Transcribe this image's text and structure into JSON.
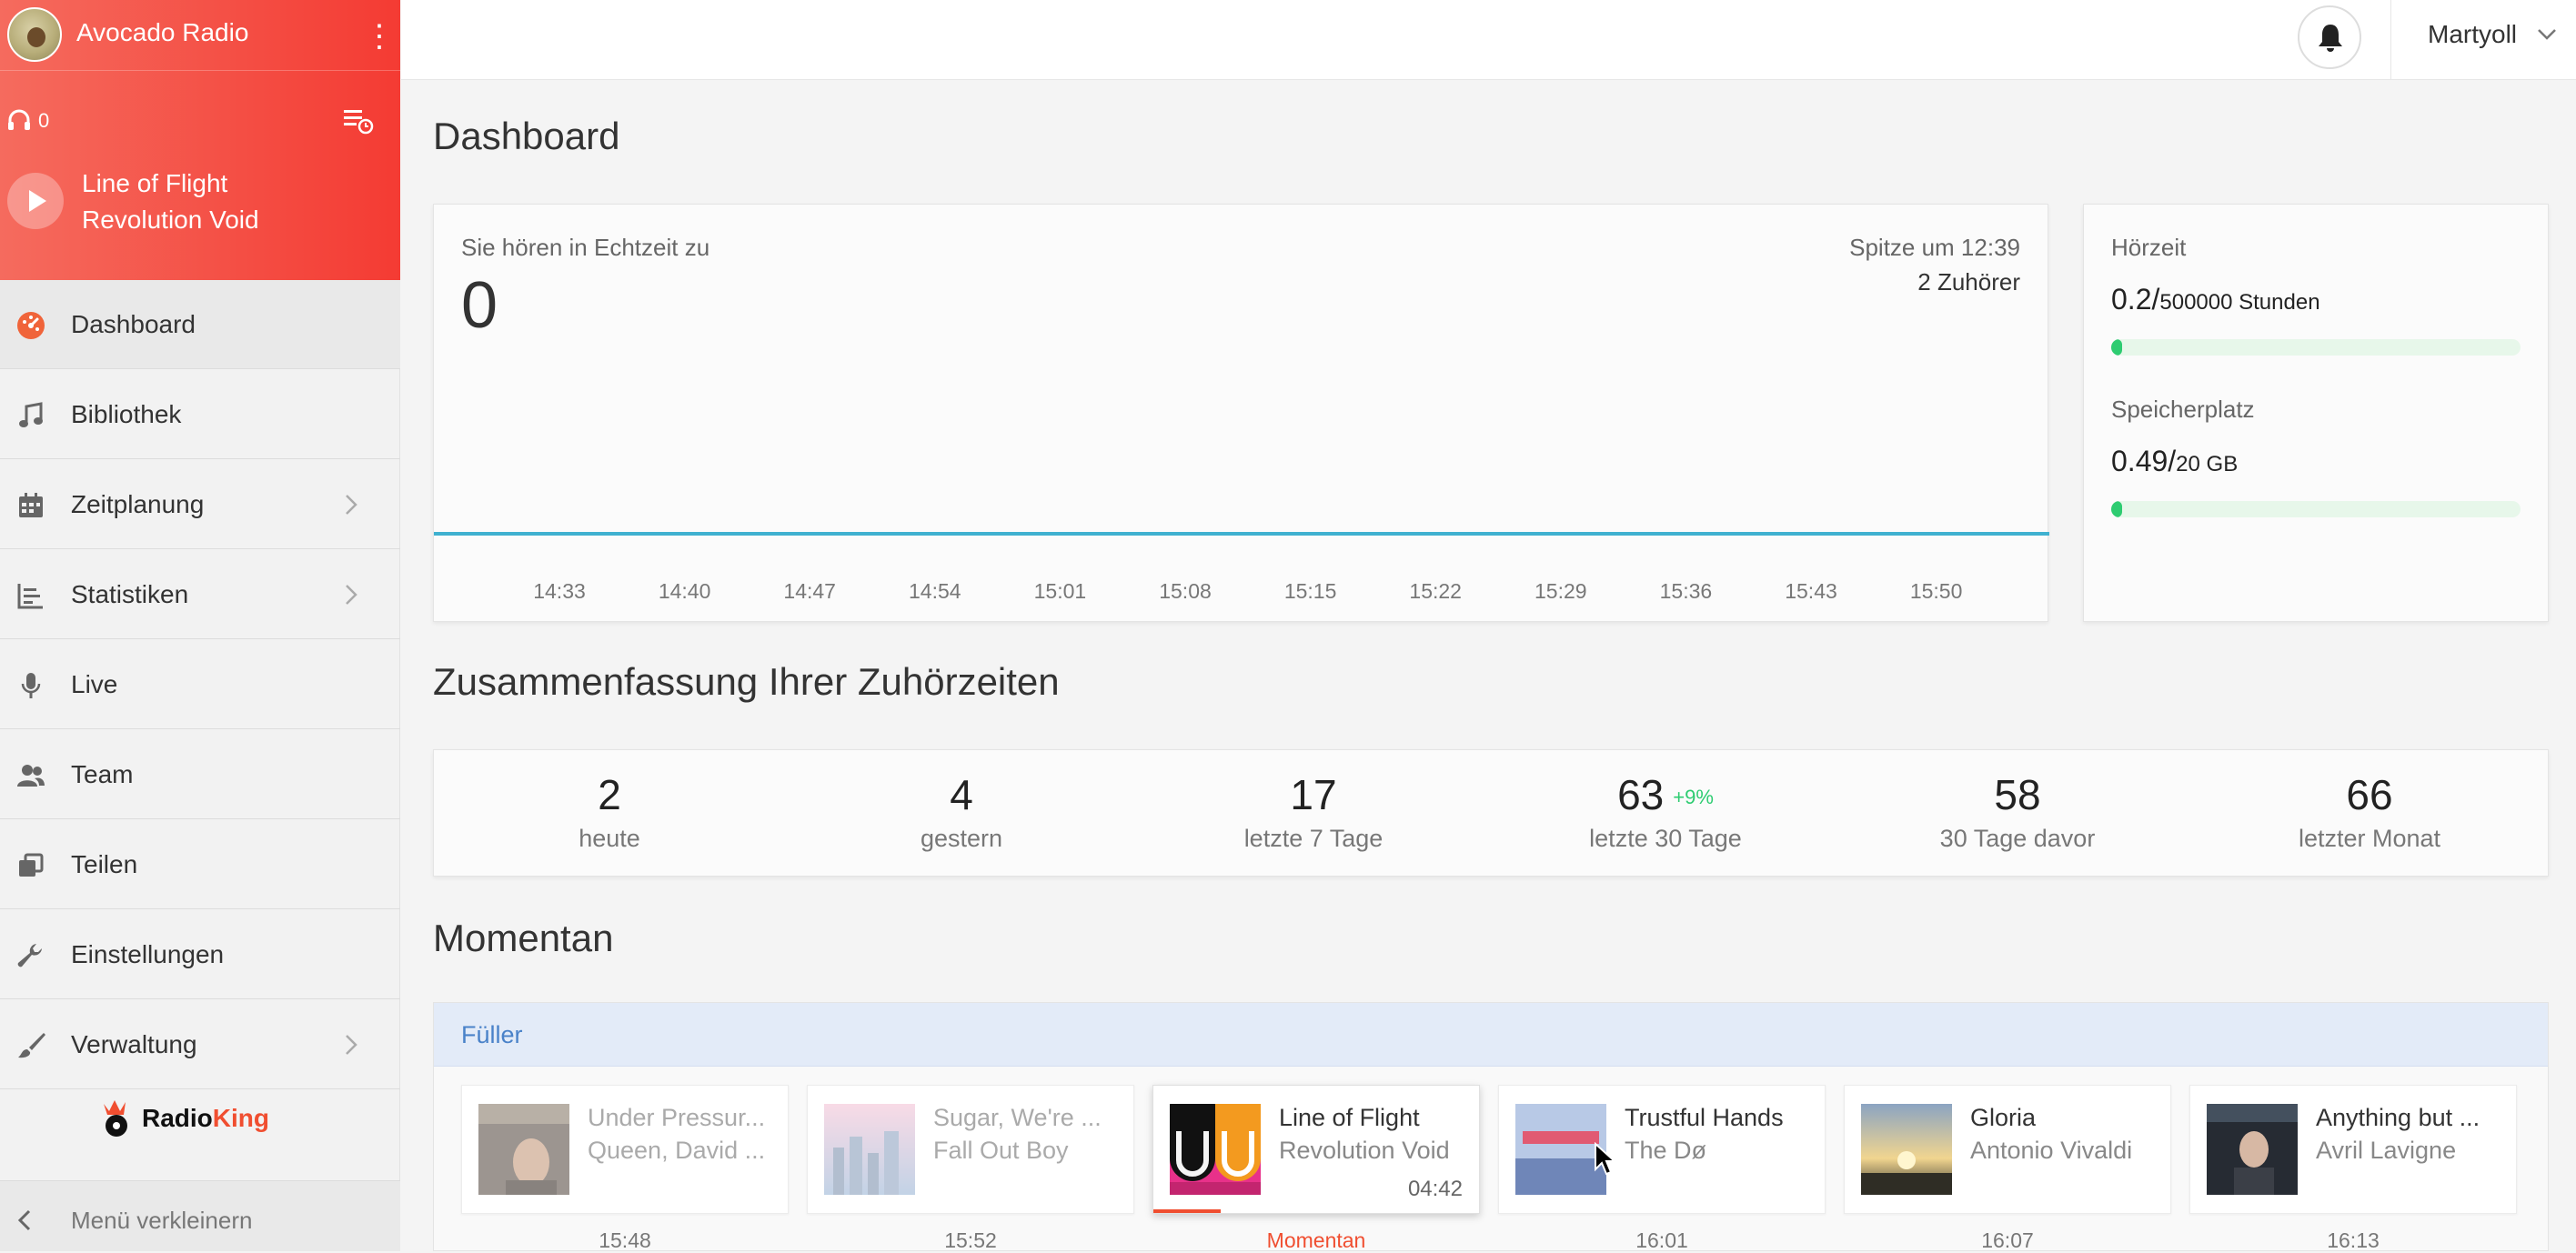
{
  "sidebar": {
    "station_name": "Avocado Radio",
    "listener_count": "0",
    "now_playing": {
      "title": "Line of Flight",
      "artist": "Revolution Void"
    },
    "items": [
      {
        "label": "Dashboard",
        "icon": "gauge-icon",
        "active": true,
        "has_submenu": false
      },
      {
        "label": "Bibliothek",
        "icon": "music-note-icon",
        "active": false,
        "has_submenu": false
      },
      {
        "label": "Zeitplanung",
        "icon": "calendar-icon",
        "active": false,
        "has_submenu": true
      },
      {
        "label": "Statistiken",
        "icon": "chart-icon",
        "active": false,
        "has_submenu": true
      },
      {
        "label": "Live",
        "icon": "microphone-icon",
        "active": false,
        "has_submenu": false
      },
      {
        "label": "Team",
        "icon": "users-icon",
        "active": false,
        "has_submenu": false
      },
      {
        "label": "Teilen",
        "icon": "share-icon",
        "active": false,
        "has_submenu": false
      },
      {
        "label": "Einstellungen",
        "icon": "wrench-icon",
        "active": false,
        "has_submenu": false
      },
      {
        "label": "Verwaltung",
        "icon": "brush-icon",
        "active": false,
        "has_submenu": true
      }
    ],
    "brand_logo": "RadioKing",
    "collapse_label": "Menü verkleinern"
  },
  "topbar": {
    "username": "Martyoll"
  },
  "main": {
    "title": "Dashboard",
    "realtime": {
      "label": "Sie hören in Echtzeit zu",
      "value": "0",
      "peak_label": "Spitze um 12:39",
      "peak_value": "2 Zuhörer",
      "ticks": [
        "14:33",
        "14:40",
        "14:47",
        "14:54",
        "15:01",
        "15:08",
        "15:15",
        "15:22",
        "15:29",
        "15:36",
        "15:43",
        "15:50"
      ]
    },
    "usage": {
      "listening_label": "Hörzeit",
      "listening_value": "0.2/",
      "listening_max": "500000 Stunden",
      "listening_fraction": 4e-07,
      "storage_label": "Speicherplatz",
      "storage_value": "0.49/",
      "storage_max": "20 GB",
      "storage_fraction": 0.0245
    },
    "summary_title": "Zusammenfassung Ihrer Zuhörzeiten",
    "summary": [
      {
        "value": "2",
        "label": "heute",
        "badge": ""
      },
      {
        "value": "4",
        "label": "gestern",
        "badge": ""
      },
      {
        "value": "17",
        "label": "letzte 7 Tage",
        "badge": ""
      },
      {
        "value": "63",
        "label": "letzte 30 Tage",
        "badge": "+9%"
      },
      {
        "value": "58",
        "label": "30 Tage davor",
        "badge": ""
      },
      {
        "value": "66",
        "label": "letzter Monat",
        "badge": ""
      }
    ],
    "momentan_title": "Momentan",
    "playlist_name": "Füller",
    "tracks": [
      {
        "title": "Under Pressur...",
        "artist": "Queen, David ...",
        "time": "15:48",
        "state": "past",
        "duration": ""
      },
      {
        "title": "Sugar, We're ...",
        "artist": "Fall Out Boy",
        "time": "15:52",
        "state": "past",
        "duration": ""
      },
      {
        "title": "Line of Flight",
        "artist": "Revolution Void",
        "time": "Momentan",
        "state": "current",
        "duration": "04:42"
      },
      {
        "title": "Trustful Hands",
        "artist": "The Dø",
        "time": "16:01",
        "state": "next",
        "duration": ""
      },
      {
        "title": "Gloria",
        "artist": "Antonio Vivaldi",
        "time": "16:07",
        "state": "next",
        "duration": ""
      },
      {
        "title": "Anything but ...",
        "artist": "Avril Lavigne",
        "time": "16:13",
        "state": "next",
        "duration": ""
      }
    ]
  },
  "colors": {
    "accent": "#f04e30",
    "header_start": "#f56b5e",
    "header_end": "#f43b33",
    "success": "#2ecc71",
    "chart_line": "#3fb1d0",
    "link": "#4a82c9"
  }
}
